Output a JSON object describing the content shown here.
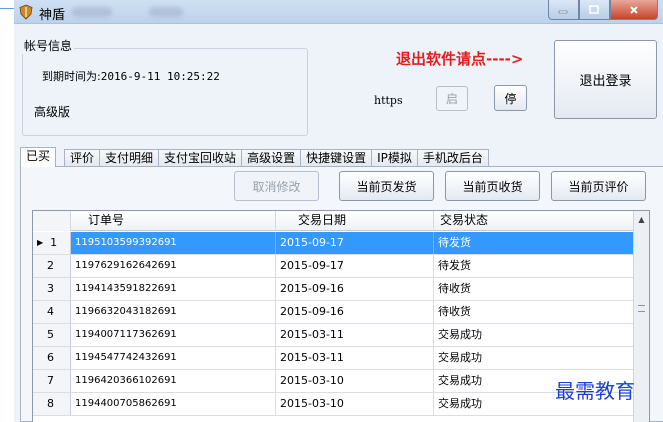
{
  "window": {
    "title": "神盾",
    "controls": [
      "minimize",
      "maximize",
      "close"
    ]
  },
  "account": {
    "group_label": "帐号信息",
    "expiry_label": "到期时间为:",
    "expiry_value": "2016-9-11 10:25:22",
    "level": "高级版"
  },
  "promo": {
    "text": "退出软件请点---->"
  },
  "protocol": {
    "label": "https",
    "start_label": "启",
    "stop_label": "停"
  },
  "logout_label": "退出登录",
  "tabs": [
    "已买",
    "评价",
    "支付明细",
    "支付宝回收站",
    "高级设置",
    "快捷键设置",
    "IP模拟",
    "手机改后台"
  ],
  "actions": {
    "cancel_edit": "取消修改",
    "ship_page": "当前页发货",
    "receive_page": "当前页收货",
    "review_page": "当前页评价"
  },
  "grid": {
    "columns": [
      "订单号",
      "交易日期",
      "交易状态"
    ],
    "selected_row": 1,
    "rows": [
      {
        "index": "1",
        "order": "1195103599392691",
        "date": "2015-09-17",
        "status": "待发货"
      },
      {
        "index": "2",
        "order": "1197629162642691",
        "date": "2015-09-17",
        "status": "待发货"
      },
      {
        "index": "3",
        "order": "1194143591822691",
        "date": "2015-09-16",
        "status": "待收货"
      },
      {
        "index": "4",
        "order": "1196632043182691",
        "date": "2015-09-16",
        "status": "待收货"
      },
      {
        "index": "5",
        "order": "1194007117362691",
        "date": "2015-03-11",
        "status": "交易成功"
      },
      {
        "index": "6",
        "order": "1194547742432691",
        "date": "2015-03-11",
        "status": "交易成功"
      },
      {
        "index": "7",
        "order": "1196420366102691",
        "date": "2015-03-10",
        "status": "交易成功"
      },
      {
        "index": "8",
        "order": "1194400705862691",
        "date": "2015-03-10",
        "status": "交易成功"
      }
    ]
  },
  "watermark": "最需教育",
  "colors": {
    "selection": "#3399ff",
    "promo": "#e02020",
    "watermark": "#1c3fd0",
    "close_button": "#c7432a"
  }
}
